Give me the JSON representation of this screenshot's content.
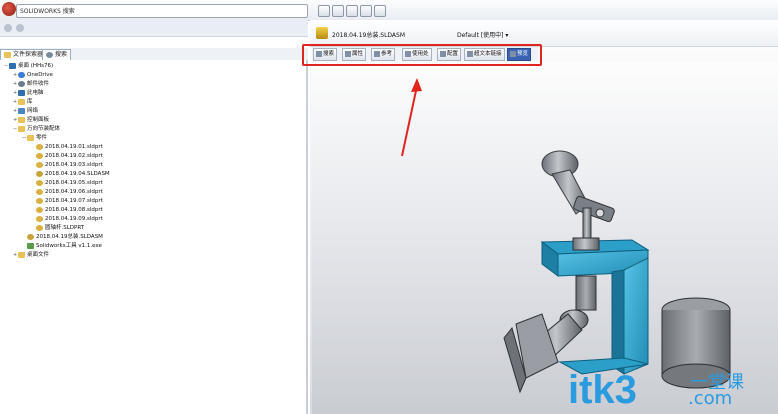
{
  "search": {
    "label": "SOLIDWORKS 搜索"
  },
  "left_tabs": [
    {
      "label": "文件探索器"
    },
    {
      "label": "搜索"
    }
  ],
  "tree": [
    {
      "label": "桌面 (HHs76)",
      "indent": 0,
      "icon": "desktop-icon",
      "expander": "−"
    },
    {
      "label": "OneDrive",
      "indent": 1,
      "icon": "cloud-icon",
      "expander": "+"
    },
    {
      "label": "邮件收件",
      "indent": 1,
      "icon": "user-icon",
      "expander": "+"
    },
    {
      "label": "此电脑",
      "indent": 1,
      "icon": "computer-icon",
      "expander": "+"
    },
    {
      "label": "库",
      "indent": 1,
      "icon": "folder-icon",
      "expander": "+"
    },
    {
      "label": "网络",
      "indent": 1,
      "icon": "network-icon",
      "expander": "+"
    },
    {
      "label": "控制面板",
      "indent": 1,
      "icon": "folder-icon",
      "expander": "+"
    },
    {
      "label": "万向节装配体",
      "indent": 1,
      "icon": "folder-icon",
      "expander": "−"
    },
    {
      "label": "零件",
      "indent": 2,
      "icon": "folder-icon",
      "expander": "−"
    },
    {
      "label": "2018.04.19.01.sldprt",
      "indent": 3,
      "icon": "part-icon",
      "expander": ""
    },
    {
      "label": "2018.04.19.02.sldprt",
      "indent": 3,
      "icon": "part-icon",
      "expander": ""
    },
    {
      "label": "2018.04.19.03.sldprt",
      "indent": 3,
      "icon": "part-icon",
      "expander": ""
    },
    {
      "label": "2018.04.19.04.SLDASM",
      "indent": 3,
      "icon": "assembly-icon",
      "expander": ""
    },
    {
      "label": "2018.04.19.05.sldprt",
      "indent": 3,
      "icon": "part-icon",
      "expander": ""
    },
    {
      "label": "2018.04.19.06.sldprt",
      "indent": 3,
      "icon": "part-icon",
      "expander": ""
    },
    {
      "label": "2018.04.19.07.sldprt",
      "indent": 3,
      "icon": "part-icon",
      "expander": ""
    },
    {
      "label": "2018.04.19.08.sldprt",
      "indent": 3,
      "icon": "part-icon",
      "expander": ""
    },
    {
      "label": "2018.04.19.09.sldprt",
      "indent": 3,
      "icon": "part-icon",
      "expander": ""
    },
    {
      "label": "圆轴杆.SLDPRT",
      "indent": 3,
      "icon": "part-icon",
      "expander": ""
    },
    {
      "label": "2018.04.19总装.SLDASM",
      "indent": 2,
      "icon": "assembly-icon",
      "expander": ""
    },
    {
      "label": "Solidworks工具 v1.1.exe",
      "indent": 2,
      "icon": "exe-icon",
      "expander": ""
    },
    {
      "label": "桌面文件",
      "indent": 1,
      "icon": "folder-icon",
      "expander": "+"
    }
  ],
  "document": {
    "title": "2018.04.19总装.SLDASM",
    "configuration": "Default [使用中] ▾"
  },
  "view_buttons": [
    {
      "label": "搜索",
      "active": false
    },
    {
      "label": "属性",
      "active": false
    },
    {
      "label": "参考",
      "active": false
    },
    {
      "label": "使用处",
      "active": false
    },
    {
      "label": "配置",
      "active": false
    },
    {
      "label": "超文本链接",
      "active": false
    },
    {
      "label": "预览",
      "active": true
    }
  ],
  "watermark": {
    "brand": "itk3",
    "cn": "一堂课",
    "domain": ".com"
  },
  "colors": {
    "model_highlight": "#2aa6cf",
    "model_body": "#8a8e95",
    "highlight_box": "#e0251f",
    "arrow": "#e0251f"
  }
}
